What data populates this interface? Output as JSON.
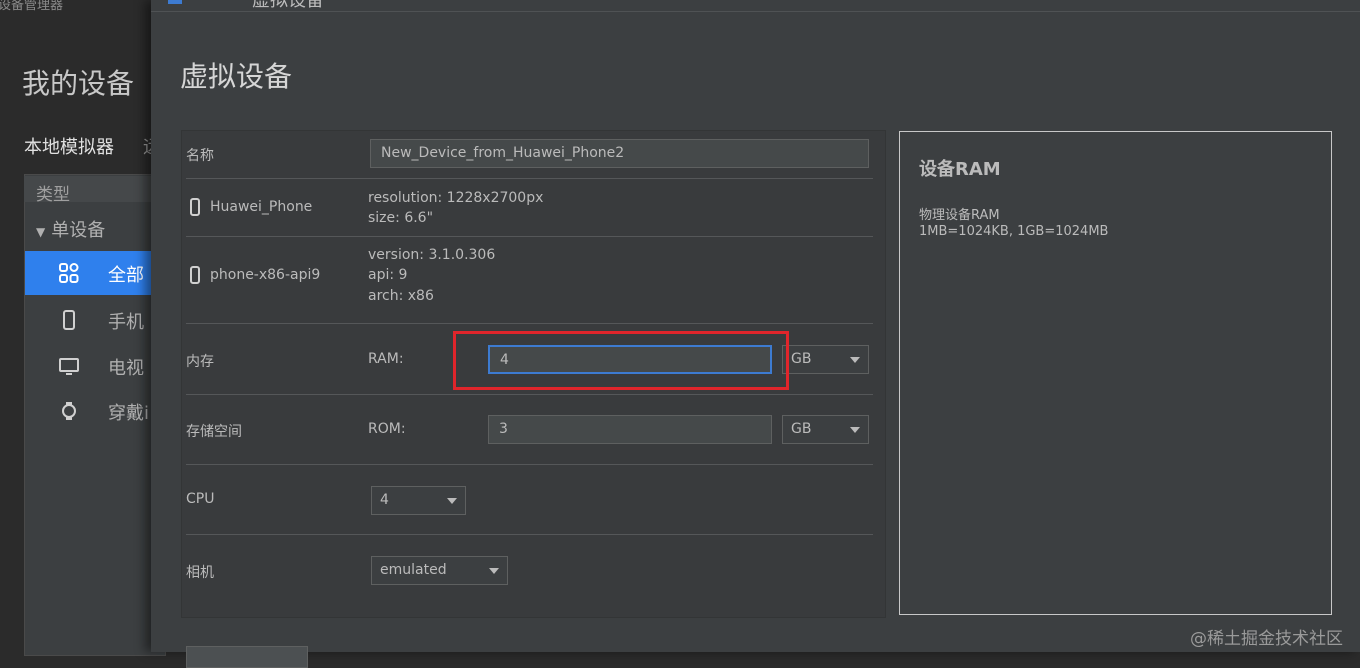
{
  "background_window": {
    "title": "设备管理器",
    "heading": "我的设备",
    "tabs": [
      "本地模拟器",
      "远"
    ],
    "type_header": "类型",
    "group": "单设备",
    "items": [
      {
        "label": "全部",
        "icon": "grid-icon",
        "selected": true
      },
      {
        "label": "手机",
        "icon": "phone-icon"
      },
      {
        "label": "电视",
        "icon": "tv-icon"
      },
      {
        "label": "穿戴i",
        "icon": "watch-icon"
      }
    ]
  },
  "dialog": {
    "title_partial": "虚拟设备",
    "heading": "虚拟设备",
    "form": {
      "name_label": "名称",
      "name_value": "New_Device_from_Huawei_Phone2",
      "device_name": "Huawei_Phone",
      "device_resolution": "resolution: 1228x2700px",
      "device_size": "size: 6.6\"",
      "image_name": "phone-x86-api9",
      "image_version": "version: 3.1.0.306",
      "image_api": "api: 9",
      "image_arch": "arch: x86",
      "memory_label": "内存",
      "ram_label": "RAM:",
      "ram_value": "4",
      "ram_unit": "GB",
      "storage_label": "存储空间",
      "rom_label": "ROM:",
      "rom_value": "3",
      "rom_unit": "GB",
      "cpu_label": "CPU",
      "cpu_value": "4",
      "camera_label": "相机",
      "camera_value": "emulated"
    },
    "info": {
      "title": "设备RAM",
      "line1": "物理设备RAM",
      "line2": "1MB=1024KB, 1GB=1024MB"
    }
  },
  "watermark": "@稀土掘金技术社区",
  "colors": {
    "accent": "#2f80ed",
    "highlight": "#e0252b",
    "focus": "#3d7bd1"
  }
}
